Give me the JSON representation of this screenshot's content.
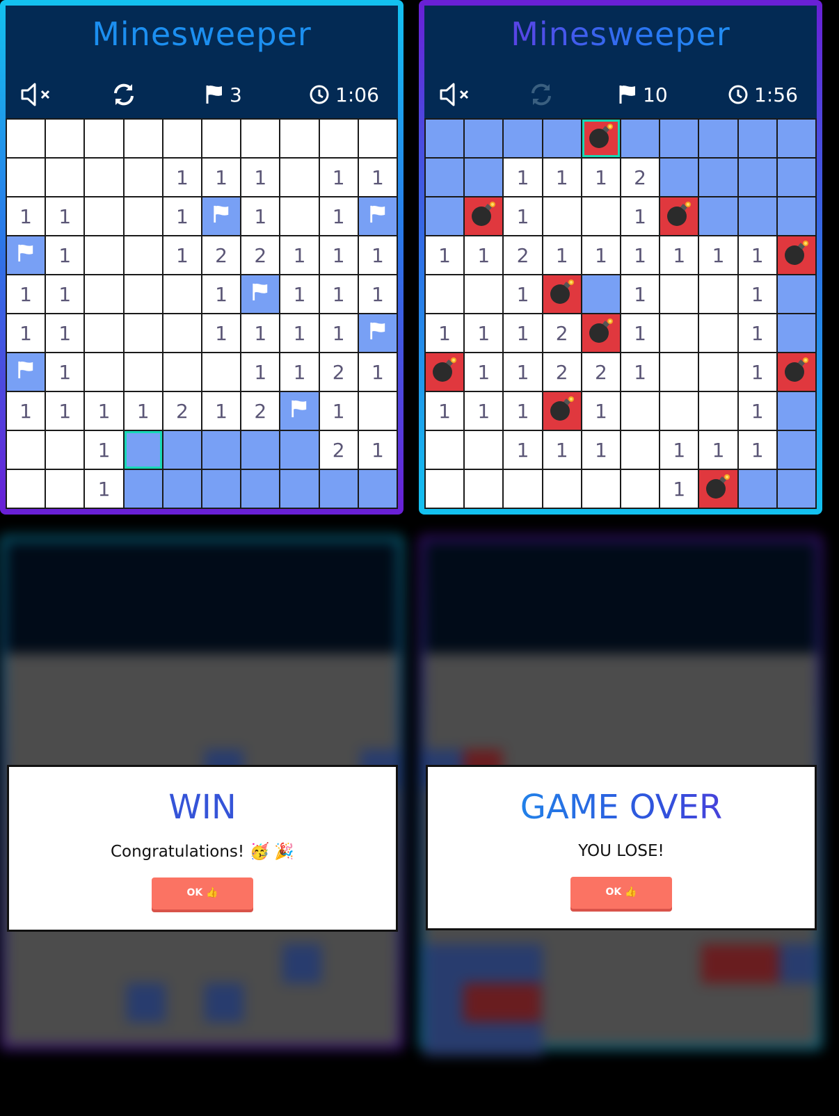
{
  "game_a": {
    "title": "Minesweeper",
    "mute_icon": "speaker-muted-icon",
    "restart_icon": "refresh-icon",
    "flag_icon": "flag-icon",
    "flags": "3",
    "clock_icon": "clock-icon",
    "time": "1:06",
    "grid": [
      [
        "",
        "",
        "",
        "",
        "",
        "",
        "",
        "",
        "",
        ""
      ],
      [
        "",
        "",
        "",
        "",
        "1",
        "1",
        "1",
        "",
        "1",
        "1"
      ],
      [
        "1",
        "1",
        "",
        "",
        "1",
        "F",
        "1",
        "",
        "1",
        "F"
      ],
      [
        "F",
        "1",
        "",
        "",
        "1",
        "2",
        "2",
        "1",
        "1",
        "1"
      ],
      [
        "1",
        "1",
        "",
        "",
        "",
        "1",
        "F",
        "1",
        "1",
        "1"
      ],
      [
        "1",
        "1",
        "",
        "",
        "",
        "1",
        "1",
        "1",
        "1",
        "F"
      ],
      [
        "F",
        "1",
        "",
        "",
        "",
        "",
        "1",
        "1",
        "2",
        "1"
      ],
      [
        "1",
        "1",
        "1",
        "1",
        "2",
        "1",
        "2",
        "F",
        "1",
        ""
      ],
      [
        "",
        "",
        "1",
        "H",
        "H",
        "H",
        "H",
        "H",
        "2",
        "1"
      ],
      [
        "",
        "",
        "1",
        "H",
        "H",
        "H",
        "H",
        "H",
        "H",
        "H"
      ]
    ],
    "selected": [
      8,
      3
    ]
  },
  "game_b": {
    "title": "Minesweeper",
    "mute_icon": "speaker-muted-icon",
    "restart_icon": "refresh-icon-disabled",
    "flag_icon": "flag-icon",
    "flags": "10",
    "clock_icon": "clock-icon",
    "time": "1:56",
    "grid": [
      [
        "H",
        "H",
        "H",
        "H",
        "B",
        "H",
        "H",
        "H",
        "H",
        "H"
      ],
      [
        "H",
        "H",
        "1",
        "1",
        "1",
        "2",
        "H",
        "H",
        "H",
        "H"
      ],
      [
        "H",
        "B",
        "1",
        "",
        "",
        "1",
        "B",
        "H",
        "H",
        "H"
      ],
      [
        "1",
        "1",
        "2",
        "1",
        "1",
        "1",
        "1",
        "1",
        "1",
        "B"
      ],
      [
        "",
        "",
        "1",
        "B",
        "H",
        "1",
        "",
        "",
        "1",
        "H"
      ],
      [
        "1",
        "1",
        "1",
        "2",
        "B",
        "1",
        "",
        "",
        "1",
        "H"
      ],
      [
        "B",
        "1",
        "1",
        "2",
        "2",
        "1",
        "",
        "",
        "1",
        "B"
      ],
      [
        "1",
        "1",
        "1",
        "B",
        "1",
        "",
        "",
        "",
        "1",
        "H"
      ],
      [
        "",
        "",
        "1",
        "1",
        "1",
        "",
        "1",
        "1",
        "1",
        "H"
      ],
      [
        "",
        "",
        "",
        "",
        "",
        "",
        "1",
        "B",
        "H",
        "H"
      ]
    ],
    "selected": [
      0,
      4
    ]
  },
  "win_modal": {
    "title": "WIN",
    "message": "Congratulations! 🥳 🎉",
    "ok_label": "OK 👍"
  },
  "lose_modal": {
    "title": "GAME OVER",
    "message": "YOU LOSE!",
    "ok_label": "OK 👍"
  },
  "colors": {
    "board_bg": "#032a54",
    "hidden_cell": "#78a0f5",
    "bomb_cell": "#e0383e",
    "selected_outline": "#17d9b6",
    "ok_button": "#fb7363"
  }
}
